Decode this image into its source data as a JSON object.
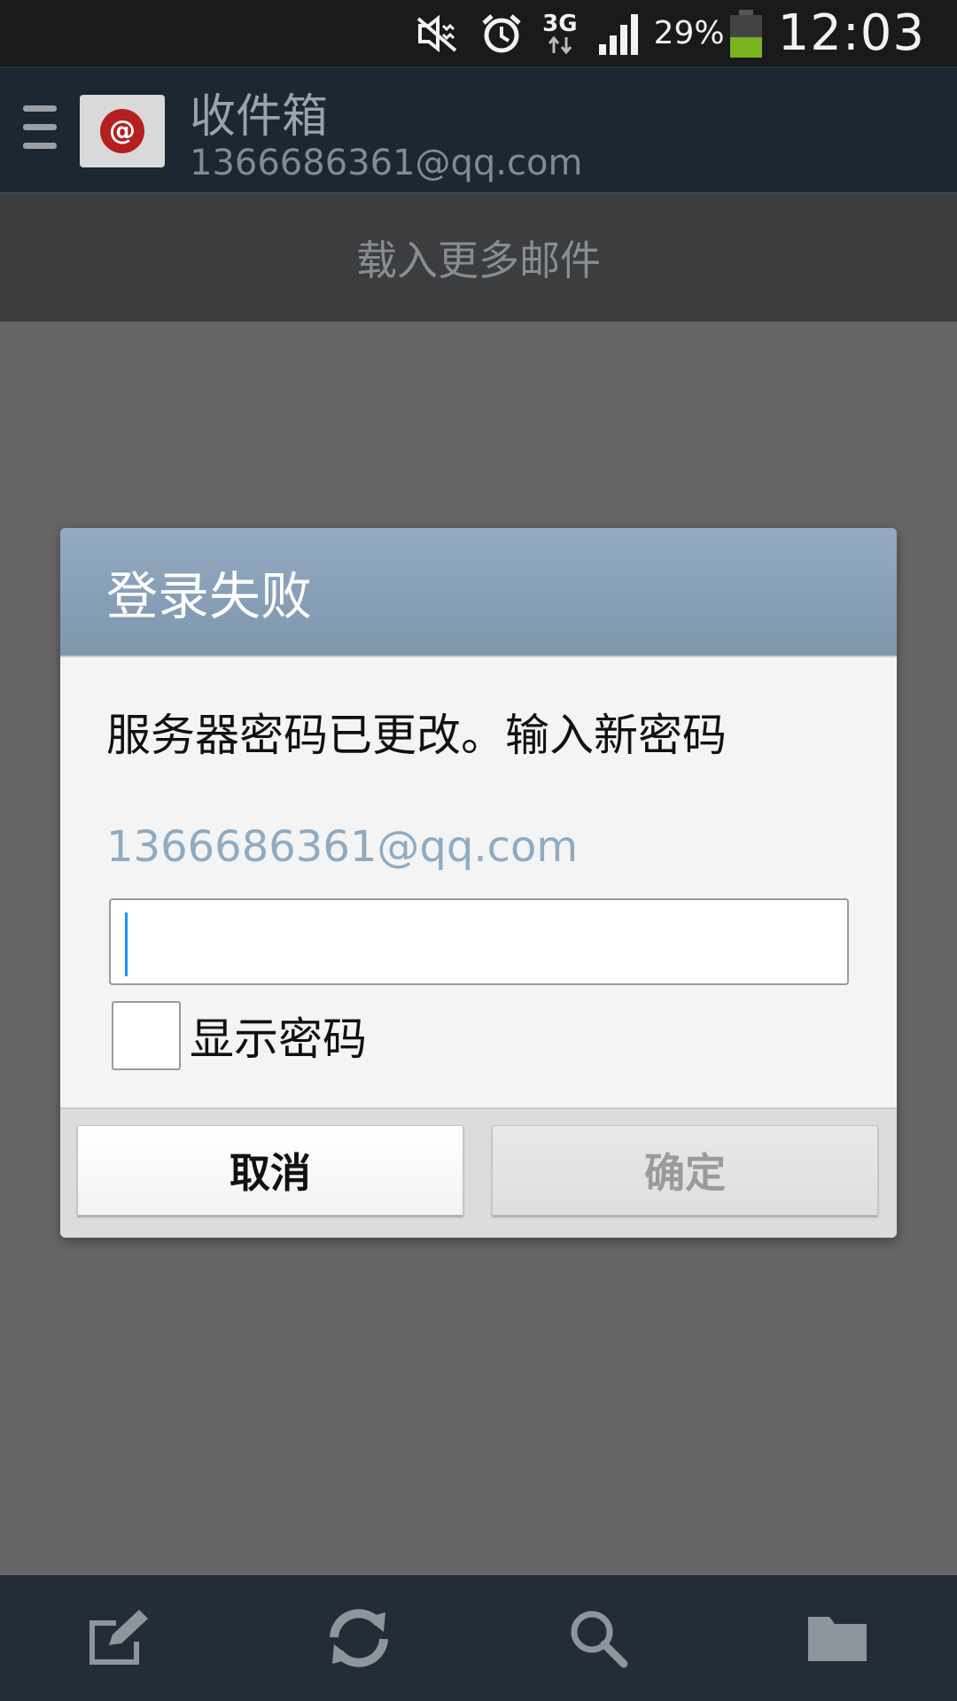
{
  "status_bar": {
    "network": "3G",
    "battery_percent": "29%",
    "time": "12:03",
    "icons": [
      "mute-icon",
      "alarm-icon",
      "network-3g-icon",
      "signal-icon",
      "battery-icon"
    ]
  },
  "header": {
    "title": "收件箱",
    "account": "1366686361@qq.com",
    "icons": [
      "menu-icon",
      "mail-app-icon"
    ]
  },
  "load_more": "载入更多邮件",
  "dialog": {
    "title": "登录失败",
    "message": "服务器密码已更改。输入新密码",
    "email": "1366686361@qq.com",
    "password_value": "",
    "show_password_label": "显示密码",
    "show_password_checked": false,
    "cancel_label": "取消",
    "ok_label": "确定"
  },
  "toolbar": {
    "icons": [
      "compose-icon",
      "refresh-icon",
      "search-icon",
      "folder-icon"
    ]
  },
  "colors": {
    "dialog_header": "#8aa3ba",
    "email_text": "#8fabc2",
    "overlay": "#666666"
  }
}
